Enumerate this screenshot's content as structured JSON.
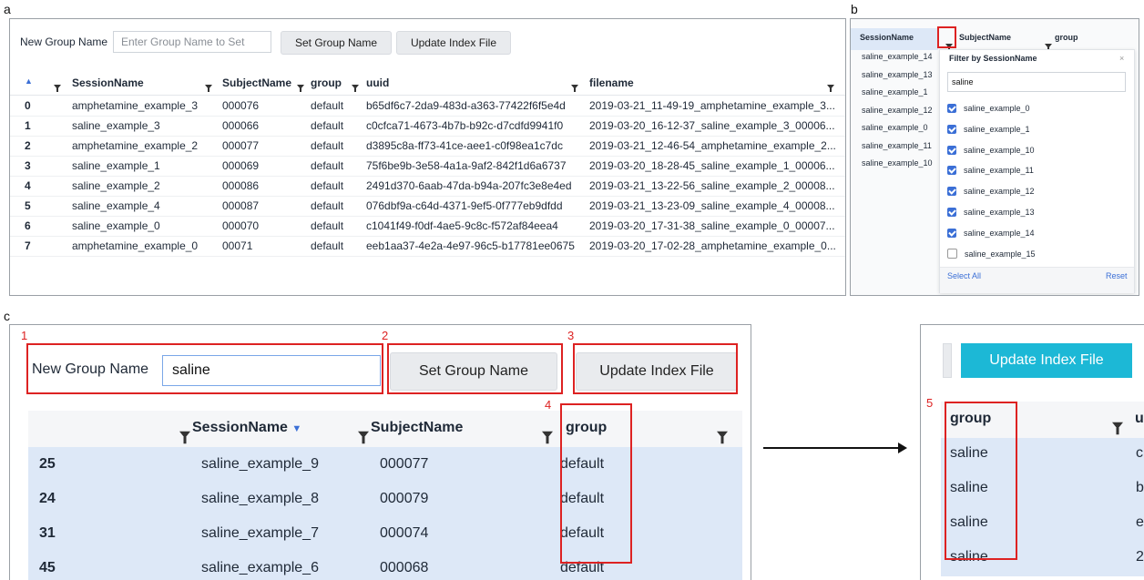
{
  "panels": {
    "a": "a",
    "b": "b",
    "c": "c"
  },
  "panel_a": {
    "new_group_label": "New Group Name",
    "input_placeholder": "Enter Group Name to Set",
    "set_button": "Set Group Name",
    "update_button": "Update Index File",
    "columns": [
      "SessionName",
      "SubjectName",
      "group",
      "uuid",
      "filename"
    ],
    "rows": [
      {
        "idx": "0",
        "session": "amphetamine_example_3",
        "subject": "000076",
        "group": "default",
        "uuid": "b65df6c7-2da9-483d-a363-77422f6f5e4d",
        "filename": "2019-03-21_11-49-19_amphetamine_example_3..."
      },
      {
        "idx": "1",
        "session": "saline_example_3",
        "subject": "000066",
        "group": "default",
        "uuid": "c0cfca71-4673-4b7b-b92c-d7cdfd9941f0",
        "filename": "2019-03-20_16-12-37_saline_example_3_00006..."
      },
      {
        "idx": "2",
        "session": "amphetamine_example_2",
        "subject": "000077",
        "group": "default",
        "uuid": "d3895c8a-ff73-41ce-aee1-c0f98ea1c7dc",
        "filename": "2019-03-21_12-46-54_amphetamine_example_2..."
      },
      {
        "idx": "3",
        "session": "saline_example_1",
        "subject": "000069",
        "group": "default",
        "uuid": "75f6be9b-3e58-4a1a-9af2-842f1d6a6737",
        "filename": "2019-03-20_18-28-45_saline_example_1_00006..."
      },
      {
        "idx": "4",
        "session": "saline_example_2",
        "subject": "000086",
        "group": "default",
        "uuid": "2491d370-6aab-47da-b94a-207fc3e8e4ed",
        "filename": "2019-03-21_13-22-56_saline_example_2_00008..."
      },
      {
        "idx": "5",
        "session": "saline_example_4",
        "subject": "000087",
        "group": "default",
        "uuid": "076dbf9a-c64d-4371-9ef5-0f777eb9dfdd",
        "filename": "2019-03-21_13-23-09_saline_example_4_00008..."
      },
      {
        "idx": "6",
        "session": "saline_example_0",
        "subject": "000070",
        "group": "default",
        "uuid": "c1041f49-f0df-4ae5-9c8c-f572af84eea4",
        "filename": "2019-03-20_17-31-38_saline_example_0_00007..."
      },
      {
        "idx": "7",
        "session": "amphetamine_example_0",
        "subject": "00071",
        "group": "default",
        "uuid": "eeb1aa37-4e2a-4e97-96c5-b17781ee0675",
        "filename": "2019-03-20_17-02-28_amphetamine_example_0..."
      }
    ]
  },
  "panel_b": {
    "col_session": "SessionName",
    "col_subject": "SubjectName",
    "col_group": "group",
    "left_list": [
      "saline_example_14",
      "saline_example_13",
      "saline_example_1",
      "saline_example_12",
      "saline_example_0",
      "saline_example_11",
      "saline_example_10"
    ],
    "popup_title": "Filter by SessionName",
    "popup_search": "saline",
    "options": [
      {
        "label": "saline_example_0",
        "checked": true
      },
      {
        "label": "saline_example_1",
        "checked": true
      },
      {
        "label": "saline_example_10",
        "checked": true
      },
      {
        "label": "saline_example_11",
        "checked": true
      },
      {
        "label": "saline_example_12",
        "checked": true
      },
      {
        "label": "saline_example_13",
        "checked": true
      },
      {
        "label": "saline_example_14",
        "checked": true
      },
      {
        "label": "saline_example_15",
        "checked": false
      }
    ],
    "select_all": "Select All",
    "reset": "Reset"
  },
  "panel_c": {
    "new_group_label": "New Group Name",
    "input_value": "saline",
    "set_button": "Set Group Name",
    "update_button": "Update Index File",
    "col_session": "SessionName",
    "col_subject": "SubjectName",
    "col_group": "group",
    "rows": [
      {
        "idx": "25",
        "session": "saline_example_9",
        "subject": "000077",
        "group": "default"
      },
      {
        "idx": "24",
        "session": "saline_example_8",
        "subject": "000079",
        "group": "default"
      },
      {
        "idx": "31",
        "session": "saline_example_7",
        "subject": "000074",
        "group": "default"
      },
      {
        "idx": "45",
        "session": "saline_example_6",
        "subject": "000068",
        "group": "default"
      }
    ],
    "markers": [
      "1",
      "2",
      "3",
      "4",
      "5"
    ]
  },
  "panel_d": {
    "update_button": "Update Index File",
    "col_group": "group",
    "col_u": "u",
    "rows": [
      {
        "group": "saline",
        "u": "c"
      },
      {
        "group": "saline",
        "u": "b"
      },
      {
        "group": "saline",
        "u": "e"
      },
      {
        "group": "saline",
        "u": "2"
      }
    ]
  },
  "colors": {
    "accent_red": "#d22222",
    "update_button_cyan": "#1cb8d6",
    "row_highlight": "#dde8f7",
    "checkbox_blue": "#3b6fd6"
  }
}
